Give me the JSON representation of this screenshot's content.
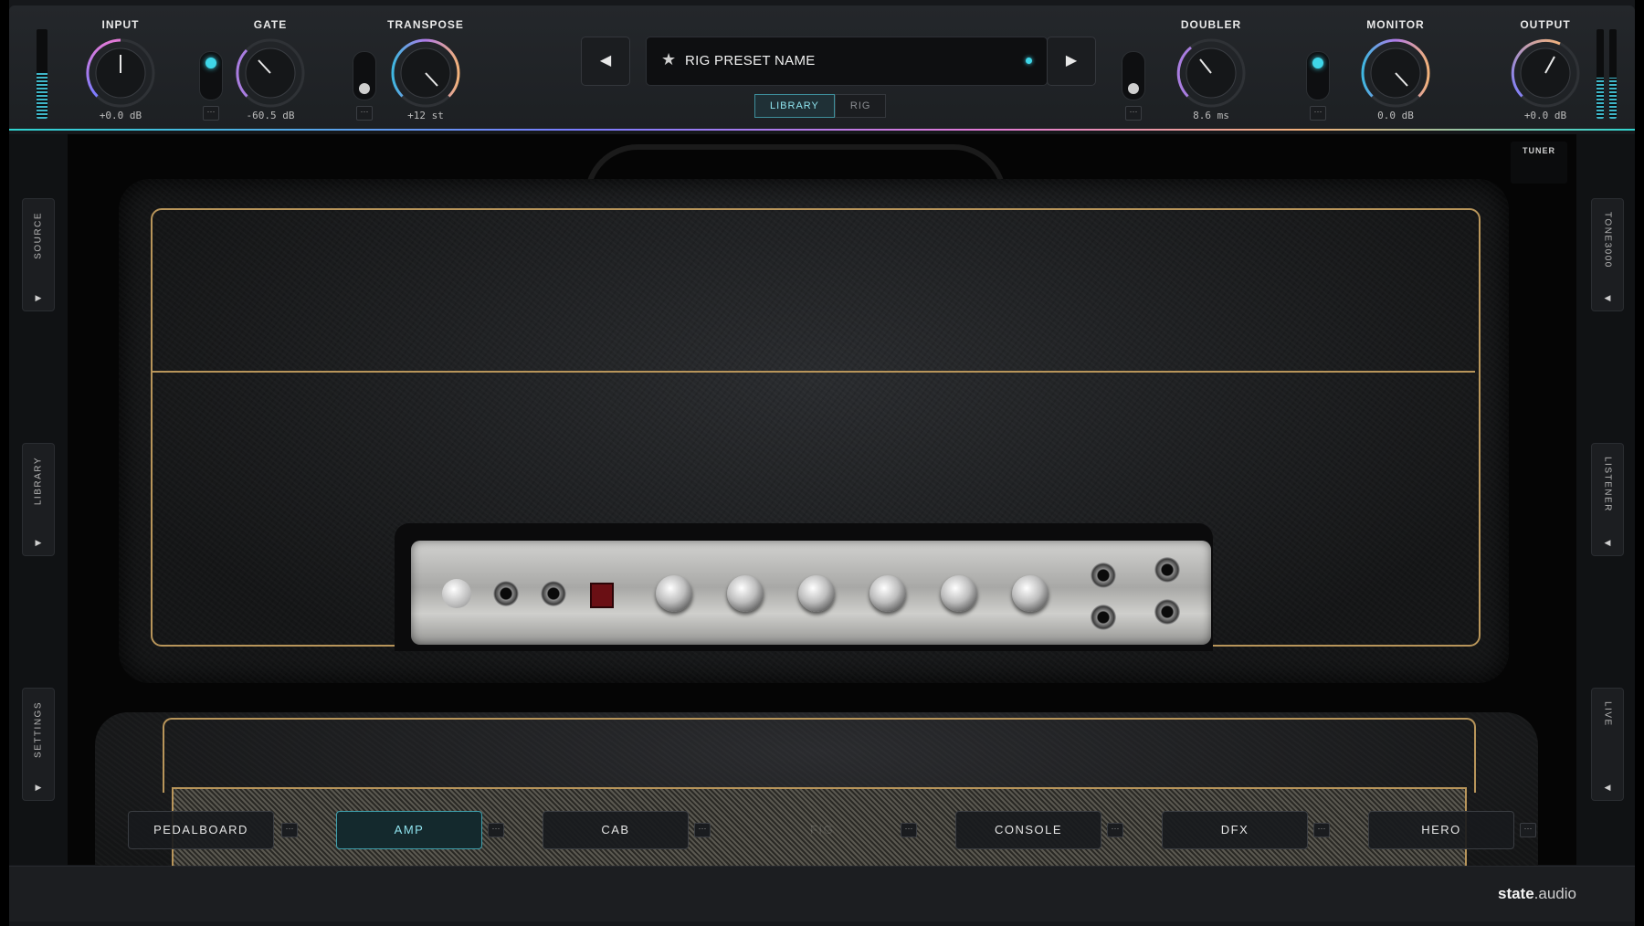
{
  "header": {
    "knobs": [
      {
        "id": "input",
        "label": "INPUT",
        "value": "+0.0 dB"
      },
      {
        "id": "gate",
        "label": "GATE",
        "value": "-60.5 dB"
      },
      {
        "id": "transpose",
        "label": "TRANSPOSE",
        "value": "+12 st"
      },
      {
        "id": "doubler",
        "label": "DOUBLER",
        "value": "8.6 ms"
      },
      {
        "id": "monitor",
        "label": "MONITOR",
        "value": "0.0 dB"
      },
      {
        "id": "output",
        "label": "OUTPUT",
        "value": "+0.0 dB"
      }
    ],
    "more_label": "···",
    "prev_symbol": "◀",
    "next_symbol": "▶"
  },
  "preset": {
    "star_symbol": "★",
    "name": "RIG PRESET NAME"
  },
  "mode_tabs": [
    {
      "label": "LIBRARY",
      "active": true
    },
    {
      "label": "RIG",
      "active": false
    }
  ],
  "tuner_label": "TUNER",
  "left_tabs": [
    {
      "label": "SOURCE",
      "arrow": "▶"
    },
    {
      "label": "LIBRARY",
      "arrow": "▶"
    },
    {
      "label": "SETTINGS",
      "arrow": "▶"
    }
  ],
  "right_tabs": [
    {
      "label": "TONE3000",
      "arrow": "◀"
    },
    {
      "label": "LISTENER",
      "arrow": "◀"
    },
    {
      "label": "LIVE",
      "arrow": "◀"
    }
  ],
  "chain_tabs": [
    {
      "label": "PEDALBOARD",
      "active": false
    },
    {
      "label": "AMP",
      "active": true
    },
    {
      "label": "CAB",
      "active": false
    },
    {
      "label": "FIG",
      "active": false
    },
    {
      "label": "CONSOLE",
      "active": false
    },
    {
      "label": "DFX",
      "active": false
    },
    {
      "label": "HERO",
      "active": false
    }
  ],
  "brand": {
    "name": "state",
    "domain": ".audio"
  },
  "colors": {
    "accent": "#3fd6e8",
    "piping": "#b8955a"
  }
}
